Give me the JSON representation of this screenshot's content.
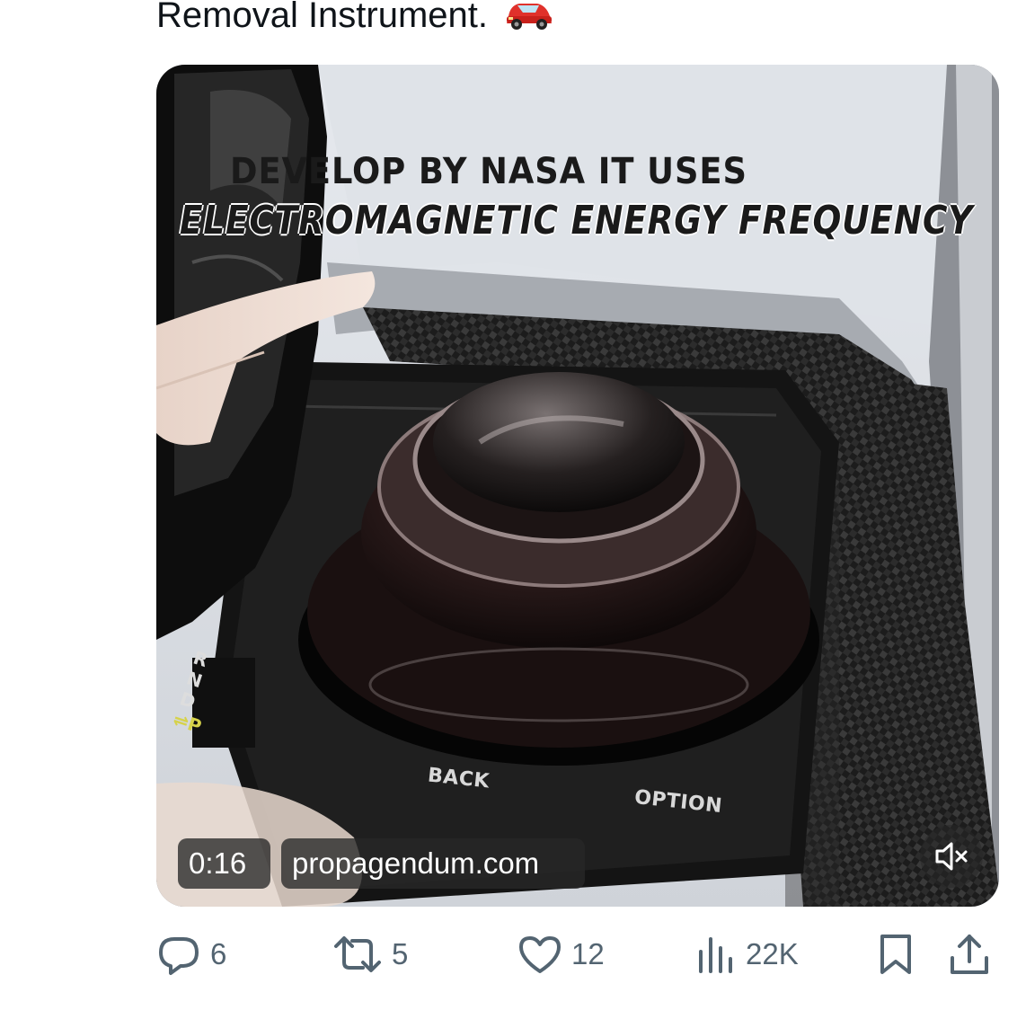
{
  "tweet": {
    "text": "Removal Instrument.",
    "emoji_icon": "red-car-emoji"
  },
  "video": {
    "caption_line1": "DEVELOP BY NASA IT USES",
    "caption_line2": "ELECTROMAGNETIC ENERGY FREQUENCY",
    "panel_label_back": "BACK",
    "panel_label_option": "OPTION",
    "gear_letters": "R\nN\nD",
    "gear_park": "⇌P",
    "timestamp": "0:16",
    "source_domain": "propagendum.com",
    "mute_icon": "speaker-muted-icon"
  },
  "actions": {
    "reply_count": "6",
    "retweet_count": "5",
    "like_count": "12",
    "views_count": "22K",
    "bookmark_icon": "bookmark-icon",
    "share_icon": "share-icon"
  },
  "colors": {
    "text_primary": "#0f1419",
    "text_secondary": "#536471",
    "overlay_bg": "#282828"
  }
}
